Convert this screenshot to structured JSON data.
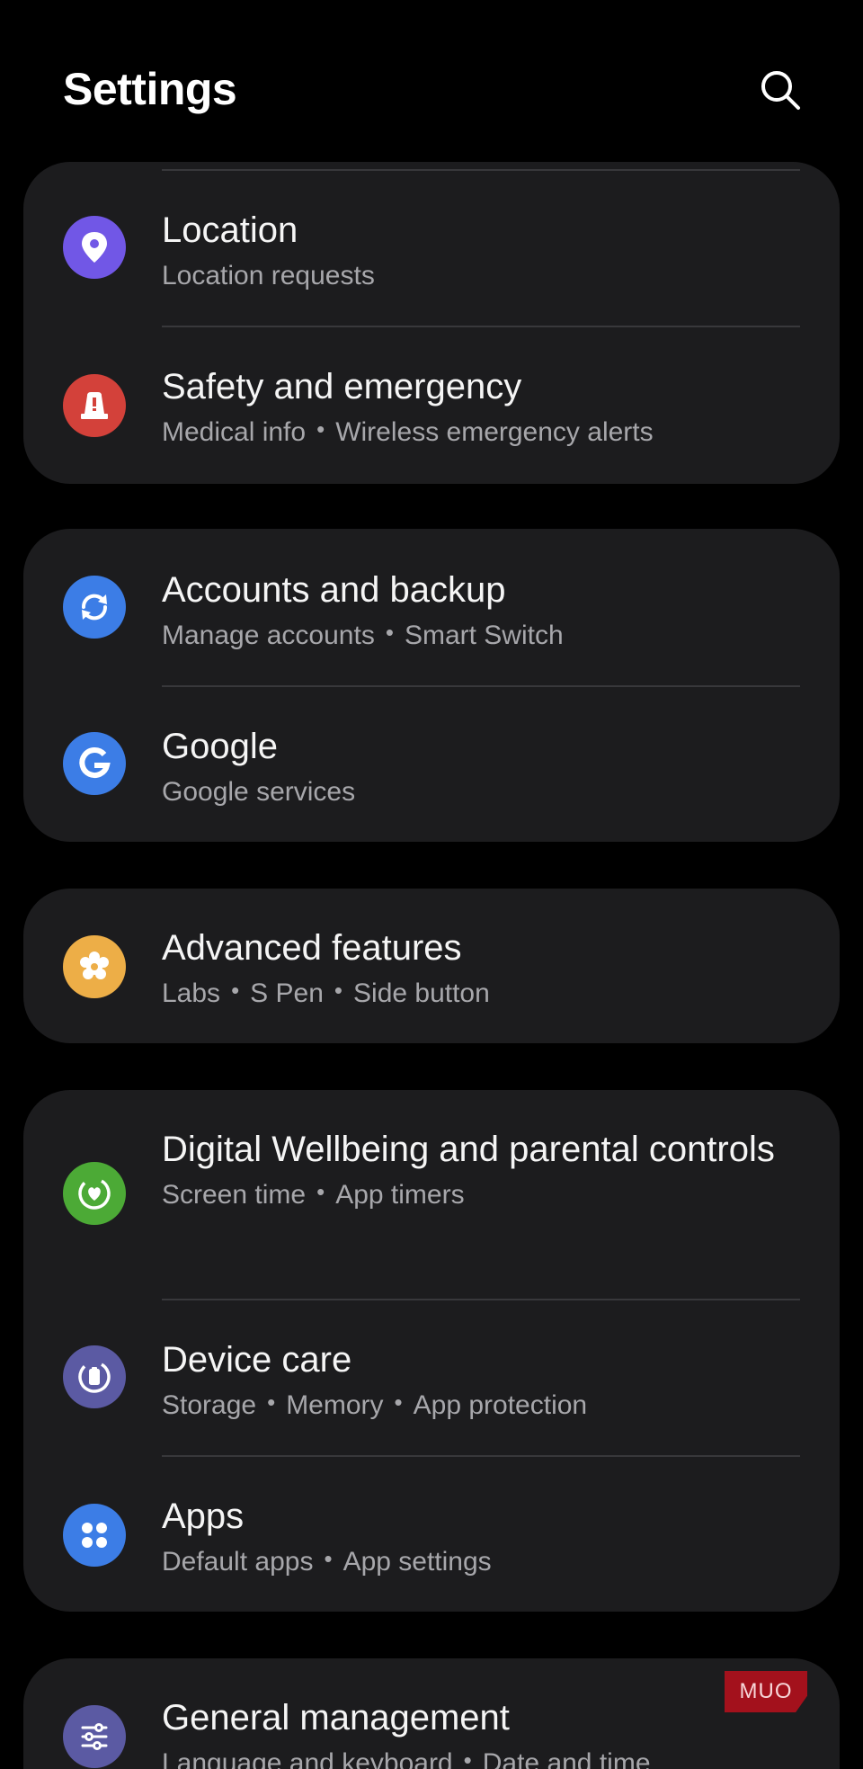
{
  "header": {
    "title": "Settings"
  },
  "groups": [
    {
      "items": [
        {
          "title": "Location",
          "subtitles": [
            "Location requests"
          ],
          "icon": "location-pin-icon",
          "color": "#7157e6"
        },
        {
          "title": "Safety and emergency",
          "subtitles": [
            "Medical info",
            "Wireless emergency alerts"
          ],
          "icon": "emergency-beacon-icon",
          "color": "#d3413a"
        }
      ]
    },
    {
      "items": [
        {
          "title": "Accounts and backup",
          "subtitles": [
            "Manage accounts",
            "Smart Switch"
          ],
          "icon": "sync-arrows-icon",
          "color": "#3c7de6"
        },
        {
          "title": "Google",
          "subtitles": [
            "Google services"
          ],
          "icon": "google-g-icon",
          "color": "#3c7de6"
        }
      ]
    },
    {
      "items": [
        {
          "title": "Advanced features",
          "subtitles": [
            "Labs",
            "S Pen",
            "Side button"
          ],
          "icon": "gear-flower-icon",
          "color": "#edae47"
        }
      ]
    },
    {
      "items": [
        {
          "title": "Digital Wellbeing and parental controls",
          "subtitles": [
            "Screen time",
            "App timers"
          ],
          "icon": "heart-ring-icon",
          "color": "#4caa36"
        },
        {
          "title": "Device care",
          "subtitles": [
            "Storage",
            "Memory",
            "App protection"
          ],
          "icon": "device-care-icon",
          "color": "#5b5aa3"
        },
        {
          "title": "Apps",
          "subtitles": [
            "Default apps",
            "App settings"
          ],
          "icon": "apps-grid-icon",
          "color": "#3c7de6"
        }
      ]
    },
    {
      "items": [
        {
          "title": "General management",
          "subtitles": [
            "Language and keyboard",
            "Date and time"
          ],
          "icon": "sliders-icon",
          "color": "#5b5aa3"
        }
      ]
    }
  ],
  "watermark": {
    "text": "MUO"
  }
}
